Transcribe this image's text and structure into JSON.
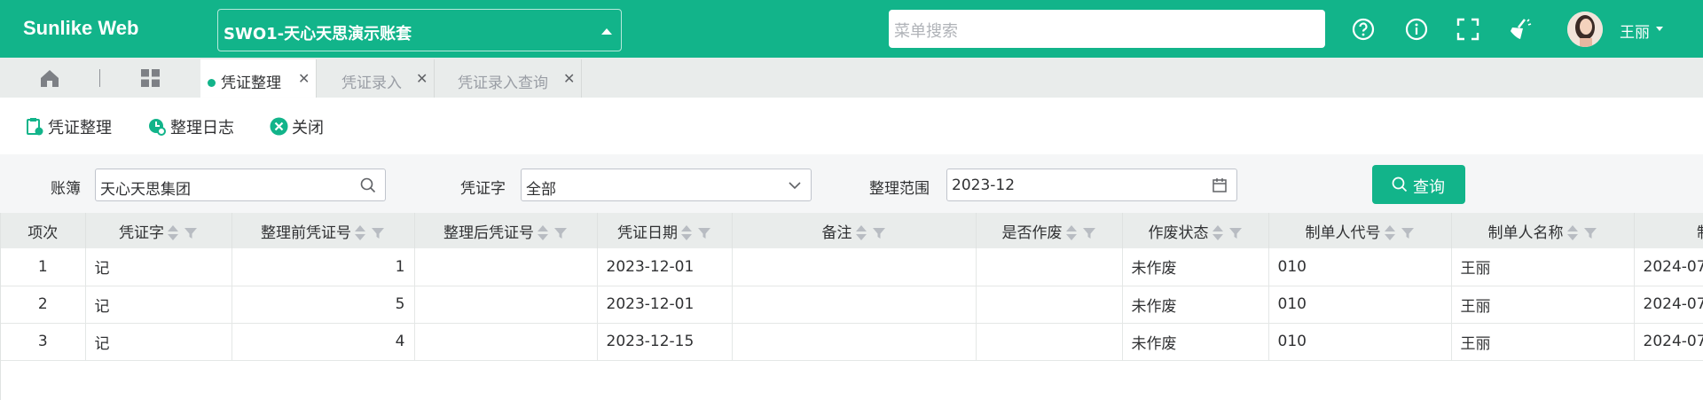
{
  "app": {
    "brand": "Sunlike Web"
  },
  "header": {
    "account_selector": "SWO1-天心天思演示账套",
    "menu_search_placeholder": "菜单搜索",
    "user_name": "王丽",
    "icons": [
      "help-icon",
      "info-icon",
      "fullscreen-icon",
      "clean-icon"
    ]
  },
  "tabs": [
    {
      "label": "凭证整理",
      "active": true
    },
    {
      "label": "凭证录入",
      "active": false
    },
    {
      "label": "凭证录入查询",
      "active": false
    }
  ],
  "toolbar": {
    "organize_label": "凭证整理",
    "log_label": "整理日志",
    "close_label": "关闭"
  },
  "filters": {
    "ledger_label": "账簿",
    "ledger_value": "天心天思集团",
    "voucher_word_label": "凭证字",
    "voucher_word_value": "全部",
    "range_label": "整理范围",
    "range_value": "2023-12",
    "query_label": "查询"
  },
  "table": {
    "columns": [
      "项次",
      "凭证字",
      "整理前凭证号",
      "整理后凭证号",
      "凭证日期",
      "备注",
      "是否作废",
      "作废状态",
      "制单人代号",
      "制单人名称",
      "制"
    ],
    "rows": [
      [
        "1",
        "记",
        "1",
        "",
        "2023-12-01",
        "",
        "",
        "未作废",
        "010",
        "王丽",
        "2024-07"
      ],
      [
        "2",
        "记",
        "5",
        "",
        "2023-12-01",
        "",
        "",
        "未作废",
        "010",
        "王丽",
        "2024-07"
      ],
      [
        "3",
        "记",
        "4",
        "",
        "2023-12-15",
        "",
        "",
        "未作废",
        "010",
        "王丽",
        "2024-07"
      ]
    ]
  },
  "colors": {
    "primary": "#12b48a",
    "tabbar": "#e9eceb",
    "header_row": "#e9eceb"
  }
}
